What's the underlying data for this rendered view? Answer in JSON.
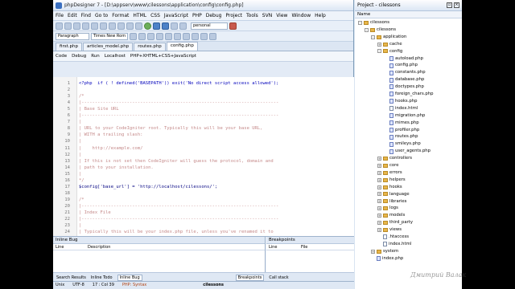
{
  "window": {
    "title": "phpDesigner 7 - [D:\\appserv\\www\\cilessons\\application\\config\\config.php]"
  },
  "menu": [
    "File",
    "Edit",
    "Find",
    "Go to",
    "Format",
    "HTML",
    "CSS",
    "JavaScript",
    "PHP",
    "Debug",
    "Project",
    "Tools",
    "SVN",
    "View",
    "Window",
    "Help"
  ],
  "toolbar": {
    "profile": "personal",
    "paragraph": "Paragraph",
    "font": "Times New Rom"
  },
  "tabs": [
    "first.php",
    "articles_model.php",
    "routes.php",
    "config.php"
  ],
  "active_tab": "config.php",
  "subtoolbar": {
    "code": "Code",
    "debug": "Debug",
    "run": "Run",
    "localhost": "Localhost",
    "php_mode": "PHP+XHTML+CSS+JavaScript"
  },
  "code_lines": [
    {
      "n": "1",
      "t": "<?php  if ( ! defined('BASEPATH')) exit('No direct script access allowed');",
      "k": "php"
    },
    {
      "n": "2",
      "t": "",
      "k": "code"
    },
    {
      "n": "3",
      "t": "/*",
      "k": "cmt"
    },
    {
      "n": "4",
      "t": "|--------------------------------------------------------------------------",
      "k": "cmt"
    },
    {
      "n": "5",
      "t": "| Base Site URL",
      "k": "cmt"
    },
    {
      "n": "6",
      "t": "|--------------------------------------------------------------------------",
      "k": "cmt"
    },
    {
      "n": "7",
      "t": "|",
      "k": "cmt"
    },
    {
      "n": "8",
      "t": "| URL to your CodeIgniter root. Typically this will be your base URL,",
      "k": "cmt"
    },
    {
      "n": "9",
      "t": "| WITH a trailing slash:",
      "k": "cmt"
    },
    {
      "n": "10",
      "t": "|",
      "k": "cmt"
    },
    {
      "n": "11",
      "t": "|    http://example.com/",
      "k": "cmt"
    },
    {
      "n": "12",
      "t": "|",
      "k": "cmt"
    },
    {
      "n": "13",
      "t": "| If this is not set then CodeIgniter will guess the protocol, domain and",
      "k": "cmt"
    },
    {
      "n": "14",
      "t": "| path to your installation.",
      "k": "cmt"
    },
    {
      "n": "15",
      "t": "|",
      "k": "cmt"
    },
    {
      "n": "16",
      "t": "*/",
      "k": "cmt"
    },
    {
      "n": "17",
      "t": "$config['base_url'] = 'http://localhost/cilessons/';",
      "k": "code"
    },
    {
      "n": "18",
      "t": "",
      "k": "code"
    },
    {
      "n": "19",
      "t": "/*",
      "k": "cmt"
    },
    {
      "n": "20",
      "t": "|--------------------------------------------------------------------------",
      "k": "cmt"
    },
    {
      "n": "21",
      "t": "| Index File",
      "k": "cmt"
    },
    {
      "n": "22",
      "t": "|--------------------------------------------------------------------------",
      "k": "cmt"
    },
    {
      "n": "23",
      "t": "|",
      "k": "cmt"
    },
    {
      "n": "24",
      "t": "| Typically this will be your index.php file, unless you've renamed it to",
      "k": "cmt"
    }
  ],
  "bottom": {
    "inline_bug": "Inline Bug",
    "col_line": "Line",
    "col_description": "Description",
    "breakpoints": "Breakpoints",
    "bp_col_line": "Line",
    "bp_col_file": "File",
    "tabs": [
      "Search Results",
      "Inline Todo",
      "Inline Bug"
    ],
    "right_tabs": [
      "Breakpoints",
      "Call stack"
    ]
  },
  "status": {
    "unix": "Unix",
    "encoding": "UTF-8",
    "position": "17 : Col 39",
    "php": "PHP: Syntax",
    "project": "cilessons"
  },
  "project_panel": {
    "title": "Project - cilessons",
    "column": "Name",
    "tree": [
      {
        "label": "cilessons",
        "d": 0,
        "type": "folder",
        "exp": "-"
      },
      {
        "label": "cilessons",
        "d": 1,
        "type": "folder",
        "exp": "-"
      },
      {
        "label": "application",
        "d": 2,
        "type": "folder",
        "exp": "-"
      },
      {
        "label": "cache",
        "d": 3,
        "type": "folder",
        "exp": "+"
      },
      {
        "label": "config",
        "d": 3,
        "type": "folder",
        "exp": "-"
      },
      {
        "label": "autoload.php",
        "d": 4,
        "type": "php"
      },
      {
        "label": "config.php",
        "d": 4,
        "type": "php"
      },
      {
        "label": "constants.php",
        "d": 4,
        "type": "php"
      },
      {
        "label": "database.php",
        "d": 4,
        "type": "php"
      },
      {
        "label": "doctypes.php",
        "d": 4,
        "type": "php"
      },
      {
        "label": "foreign_chars.php",
        "d": 4,
        "type": "php"
      },
      {
        "label": "hooks.php",
        "d": 4,
        "type": "php"
      },
      {
        "label": "index.html",
        "d": 4,
        "type": "file"
      },
      {
        "label": "migration.php",
        "d": 4,
        "type": "php"
      },
      {
        "label": "mimes.php",
        "d": 4,
        "type": "php"
      },
      {
        "label": "profiler.php",
        "d": 4,
        "type": "php"
      },
      {
        "label": "routes.php",
        "d": 4,
        "type": "php"
      },
      {
        "label": "smileys.php",
        "d": 4,
        "type": "php"
      },
      {
        "label": "user_agents.php",
        "d": 4,
        "type": "php"
      },
      {
        "label": "controllers",
        "d": 3,
        "type": "folder",
        "exp": "+"
      },
      {
        "label": "core",
        "d": 3,
        "type": "folder",
        "exp": "+"
      },
      {
        "label": "errors",
        "d": 3,
        "type": "folder",
        "exp": "+"
      },
      {
        "label": "helpers",
        "d": 3,
        "type": "folder",
        "exp": "+"
      },
      {
        "label": "hooks",
        "d": 3,
        "type": "folder",
        "exp": "+"
      },
      {
        "label": "language",
        "d": 3,
        "type": "folder",
        "exp": "+"
      },
      {
        "label": "libraries",
        "d": 3,
        "type": "folder",
        "exp": "+"
      },
      {
        "label": "logs",
        "d": 3,
        "type": "folder",
        "exp": "+"
      },
      {
        "label": "models",
        "d": 3,
        "type": "folder",
        "exp": "+"
      },
      {
        "label": "third_party",
        "d": 3,
        "type": "folder",
        "exp": "+"
      },
      {
        "label": "views",
        "d": 3,
        "type": "folder",
        "exp": "+"
      },
      {
        "label": ".htaccess",
        "d": 3,
        "type": "file"
      },
      {
        "label": "index.html",
        "d": 3,
        "type": "file"
      },
      {
        "label": "system",
        "d": 2,
        "type": "folder",
        "exp": "+"
      },
      {
        "label": "index.php",
        "d": 2,
        "type": "php"
      }
    ]
  },
  "watermark": "Дмитрий Валак"
}
